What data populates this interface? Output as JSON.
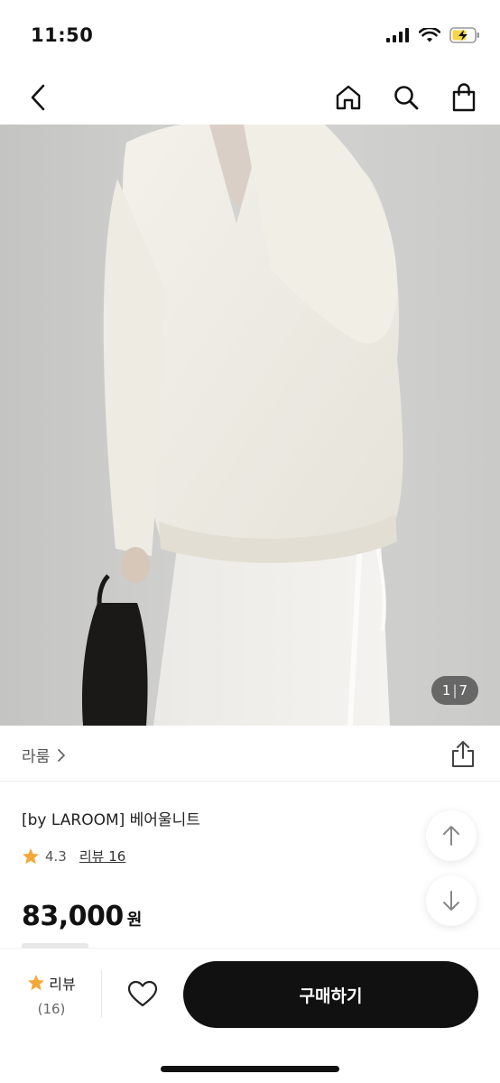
{
  "status": {
    "time": "11:50"
  },
  "gallery": {
    "current": "1",
    "separator": "|",
    "total": "7"
  },
  "brand": {
    "name": "라룸"
  },
  "product": {
    "title": "[by LAROOM] 베어울니트",
    "rating": "4.3",
    "review_label": "리뷰 16",
    "price": "83,000",
    "price_unit": "원"
  },
  "bottom": {
    "review_label": "리뷰",
    "review_count": "(16)",
    "buy_label": "구매하기"
  },
  "colors": {
    "accent_star": "#F2A93B",
    "buy_button": "#111111"
  },
  "icons": [
    "back-icon",
    "home-icon",
    "search-icon",
    "shopping-bag-icon",
    "share-icon",
    "arrow-up-icon",
    "arrow-down-icon",
    "star-icon",
    "heart-icon"
  ]
}
